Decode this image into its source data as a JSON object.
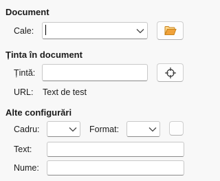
{
  "document": {
    "section_title": "Document",
    "path_label": "Cale:",
    "path_value": ""
  },
  "target": {
    "section_title": "Ținta în document",
    "target_label": "Țintă:",
    "target_value": "",
    "url_label": "URL:",
    "url_value": "Text de test"
  },
  "other": {
    "section_title": "Alte configurări",
    "frame_label": "Cadru:",
    "frame_value": "",
    "format_label": "Format:",
    "format_value": "",
    "text_label": "Text:",
    "text_value": "",
    "name_label": "Nume:",
    "name_value": ""
  },
  "icons": {
    "open_file": "folder-open-icon",
    "target_picker": "crosshair-icon",
    "dropdown": "chevron-down-icon"
  },
  "colors": {
    "folder": "#f0a23a",
    "background": "#f8f8f8"
  }
}
